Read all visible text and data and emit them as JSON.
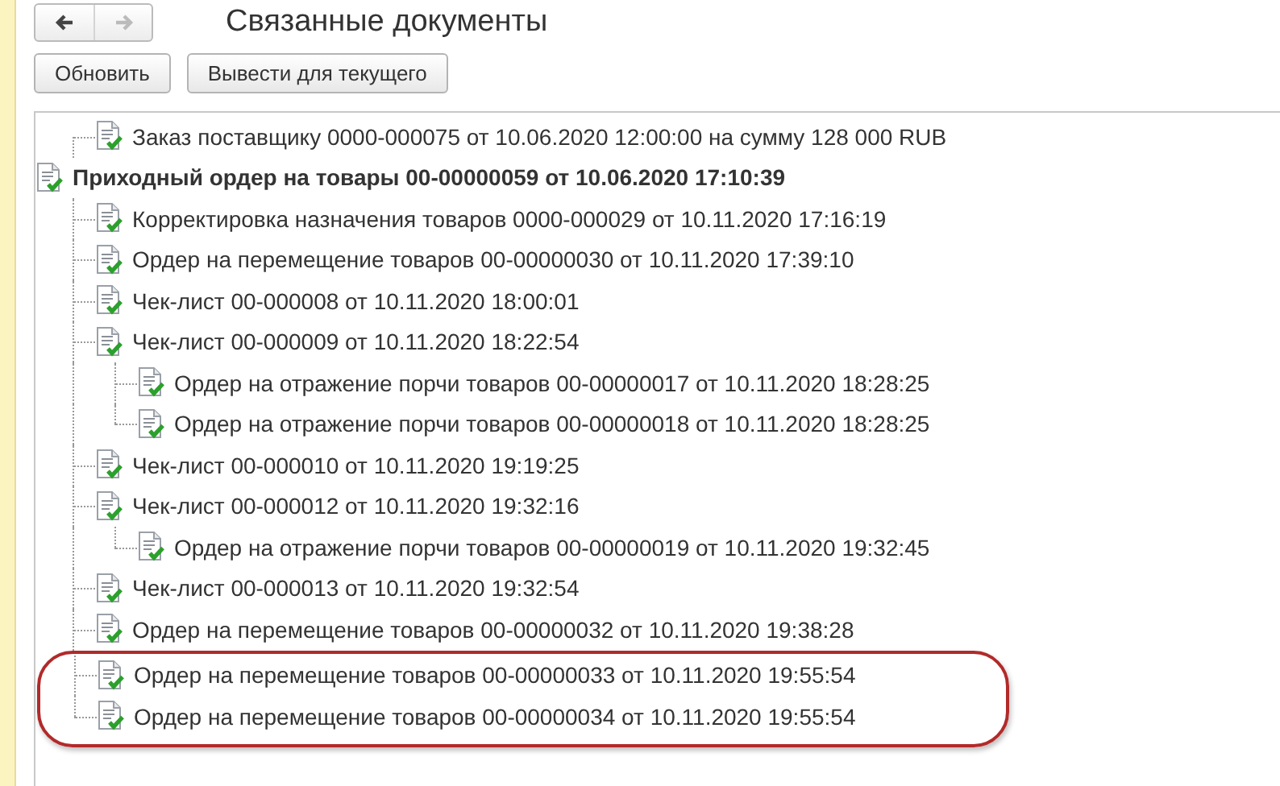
{
  "navigation": {
    "back": {
      "disabled": false
    },
    "forward": {
      "disabled": true
    }
  },
  "title": "Связанные документы",
  "buttons": [
    "Обновить",
    "Вывести для текущего"
  ],
  "tree": {
    "basis": [
      {
        "text": "Заказ поставщику 0000-000075 от 10.06.2020 12:00:00 на сумму 128 000 RUB",
        "highlighted": false
      }
    ],
    "document": {
      "text": "Приходный ордер на товары 00-00000059 от 10.06.2020 17:10:39",
      "children": [
        {
          "text": "Корректировка назначения товаров 0000-000029 от 10.11.2020 17:16:19",
          "highlighted": false
        },
        {
          "text": "Ордер на перемещение товаров 00-00000030 от 10.11.2020 17:39:10",
          "highlighted": false
        },
        {
          "text": "Чек-лист 00-000008 от 10.11.2020 18:00:01",
          "highlighted": false
        },
        {
          "text": "Чек-лист 00-000009 от 10.11.2020 18:22:54",
          "highlighted": false,
          "children": [
            {
              "text": "Ордер на отражение порчи товаров 00-00000017 от 10.11.2020 18:28:25",
              "highlighted": false
            },
            {
              "text": "Ордер на отражение порчи товаров 00-00000018 от 10.11.2020 18:28:25",
              "highlighted": false
            }
          ]
        },
        {
          "text": "Чек-лист 00-000010 от 10.11.2020 19:19:25",
          "highlighted": false
        },
        {
          "text": "Чек-лист 00-000012 от 10.11.2020 19:32:16",
          "highlighted": false,
          "children": [
            {
              "text": "Ордер на отражение порчи товаров 00-00000019 от 10.11.2020 19:32:45",
              "highlighted": false
            }
          ]
        },
        {
          "text": "Чек-лист 00-000013 от 10.11.2020 19:32:54",
          "highlighted": false
        },
        {
          "text": "Ордер на перемещение товаров 00-00000032 от 10.11.2020 19:38:28",
          "highlighted": false
        },
        {
          "text": "Ордер на перемещение товаров 00-00000033 от 10.11.2020 19:55:54",
          "highlighted": true
        },
        {
          "text": "Ордер на перемещение товаров 00-00000034 от 10.11.2020 19:55:54",
          "highlighted": true
        }
      ]
    }
  }
}
